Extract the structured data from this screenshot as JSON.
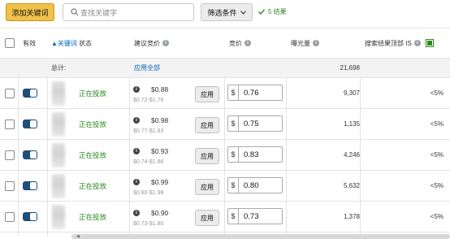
{
  "toolbar": {
    "add_keyword_label": "添加关键词",
    "search_placeholder": "查找关键字",
    "filter_label": "筛选条件",
    "result_count": "5 结果"
  },
  "table": {
    "headers": {
      "active": "有效",
      "keyword": "▲关键词",
      "status": "状态",
      "suggested_bid": "建议竞价",
      "bid": "竞价",
      "impressions": "曝光量",
      "top_of_search": "搜索结果顶部 IS"
    },
    "total_row": {
      "label": "总计:",
      "apply_all": "应用全部",
      "impressions": "21,698"
    },
    "apply_label": "应用",
    "currency": "$",
    "rows": [
      {
        "status": "正在投放",
        "suggested": "$0.88",
        "range": "$0.72-$1.76",
        "bid": "0.76",
        "impressions": "9,307",
        "top_is": "<5%"
      },
      {
        "status": "正在投放",
        "suggested": "$0.98",
        "range": "$0.77-$1.83",
        "bid": "0.75",
        "impressions": "1,135",
        "top_is": "<5%"
      },
      {
        "status": "正在投放",
        "suggested": "$0.93",
        "range": "$0.74-$1.86",
        "bid": "0.83",
        "impressions": "4,246",
        "top_is": "<5%"
      },
      {
        "status": "正在投放",
        "suggested": "$0.99",
        "range": "$0.80-$1.98",
        "bid": "0.80",
        "impressions": "5,632",
        "top_is": "<5%"
      },
      {
        "status": "正在投放",
        "suggested": "$0.90",
        "range": "$0.73-$1.80",
        "bid": "0.73",
        "impressions": "1,378",
        "top_is": "<5%"
      }
    ]
  },
  "colors": {
    "add_button": "#f0c14b",
    "status_green": "#2b8a1f",
    "toggle_on": "#1f4e79",
    "link": "#0066c0"
  }
}
